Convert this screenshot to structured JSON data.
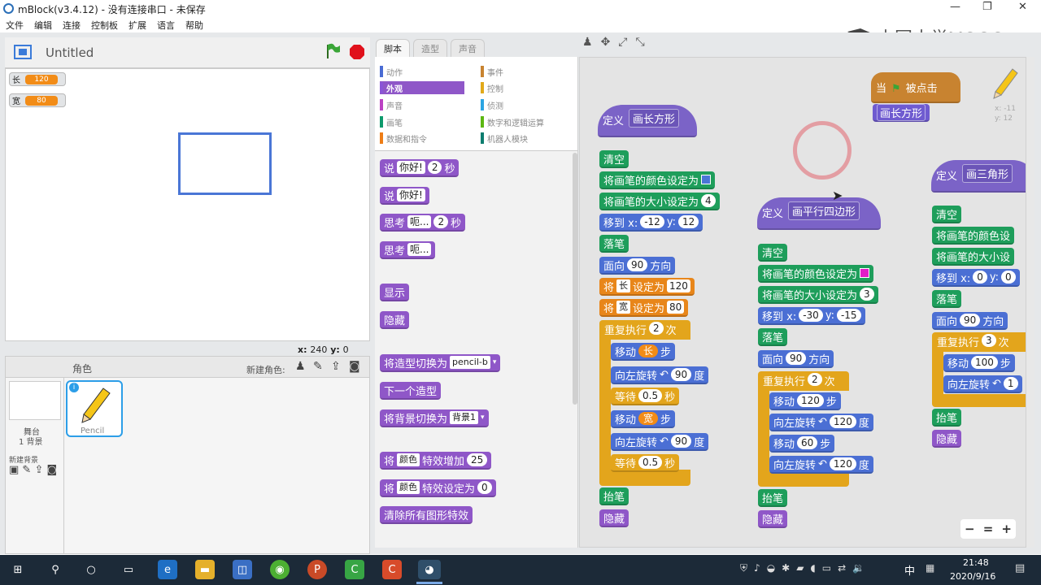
{
  "window": {
    "title": "mBlock(v3.4.12) - 没有连接串口 - 未保存",
    "minimize": "—",
    "maximize": "❐",
    "close": "✕"
  },
  "menu": [
    "文件",
    "编辑",
    "连接",
    "控制板",
    "扩展",
    "语言",
    "帮助"
  ],
  "watermark": "中国大学MOOC",
  "stage": {
    "title": "Untitled",
    "monitors": [
      {
        "label": "长",
        "value": "120"
      },
      {
        "label": "宽",
        "value": "80"
      }
    ],
    "coords": {
      "x_label": "x:",
      "x": "240",
      "y_label": "y:",
      "y": "0"
    }
  },
  "sprites": {
    "header": "角色",
    "new_sprite": "新建角色:",
    "stage_label": "舞台",
    "stage_bg": "1 背景",
    "new_bg": "新建背景",
    "sprite_name": "Pencil"
  },
  "tabs": [
    "脚本",
    "造型",
    "声音"
  ],
  "categories_left": [
    {
      "label": "动作",
      "color": "#4a6cd4"
    },
    {
      "label": "外观",
      "color": "#8a55d7"
    },
    {
      "label": "声音",
      "color": "#bb42c3"
    },
    {
      "label": "画笔",
      "color": "#0e9a6c"
    },
    {
      "label": "数据和指令",
      "color": "#ee7d16"
    }
  ],
  "categories_right": [
    {
      "label": "事件",
      "color": "#c88330"
    },
    {
      "label": "控制",
      "color": "#e1a91a"
    },
    {
      "label": "侦测",
      "color": "#2ca5e2"
    },
    {
      "label": "数字和逻辑运算",
      "color": "#5cb712"
    },
    {
      "label": "机器人模块",
      "color": "#0c7d6f"
    }
  ],
  "palette": {
    "say_secs": {
      "t1": "说",
      "in": "你好!",
      "n": "2",
      "t2": "秒"
    },
    "say": {
      "t1": "说",
      "in": "你好!"
    },
    "think_secs": {
      "t1": "思考",
      "in": "呃...",
      "n": "2",
      "t2": "秒"
    },
    "think": {
      "t1": "思考",
      "in": "呃..."
    },
    "show": "显示",
    "hide": "隐藏",
    "switch_costume": {
      "t": "将造型切换为",
      "v": "pencil-b"
    },
    "next_costume": "下一个造型",
    "switch_bg": {
      "t": "将背景切换为",
      "v": "背景1"
    },
    "change_effect": {
      "t1": "将",
      "v": "颜色",
      "t2": "特效增加",
      "n": "25"
    },
    "set_effect": {
      "t1": "将",
      "v": "颜色",
      "t2": "特效设定为",
      "n": "0"
    },
    "clear_effects": "清除所有图形特效"
  },
  "scripts": {
    "when_flag": {
      "t1": "当",
      "t2": "被点击",
      "call": "画长方形"
    },
    "rect": {
      "define": "定义",
      "name": "画长方形",
      "clear": "清空",
      "set_color": "将画笔的颜色设定为",
      "set_size": "将画笔的大小设定为",
      "size": "4",
      "goto": "移到 x:",
      "x": "-12",
      "y_lbl": "y:",
      "y": "12",
      "pen_down": "落笔",
      "point": "面向",
      "dir": "90",
      "dir_t": "方向",
      "set1": {
        "t1": "将",
        "var": "长",
        "t2": "设定为",
        "v": "120"
      },
      "set2": {
        "t1": "将",
        "var": "宽",
        "t2": "设定为",
        "v": "80"
      },
      "repeat": "重复执行",
      "times": "2",
      "times_t": "次",
      "move": "移动",
      "step": "步",
      "var_len": "长",
      "var_wid": "宽",
      "turn": "向左旋转",
      "deg": "90",
      "deg_t": "度",
      "wait": "等待",
      "secs": "0.5",
      "secs_t": "秒",
      "pen_up": "抬笔",
      "hide": "隐藏"
    },
    "para": {
      "define": "定义",
      "name": "画平行四边形",
      "clear": "清空",
      "set_color": "将画笔的颜色设定为",
      "set_size": "将画笔的大小设定为",
      "size": "3",
      "goto": "移到 x:",
      "x": "-30",
      "y_lbl": "y:",
      "y": "-15",
      "pen_down": "落笔",
      "point": "面向",
      "dir": "90",
      "dir_t": "方向",
      "repeat": "重复执行",
      "times": "2",
      "times_t": "次",
      "move": "移动",
      "m1": "120",
      "m2": "60",
      "step": "步",
      "turn": "向左旋转",
      "deg": "120",
      "deg_t": "度",
      "pen_up": "抬笔",
      "hide": "隐藏"
    },
    "tri": {
      "define": "定义",
      "name": "画三角形",
      "clear": "清空",
      "set_color": "将画笔的颜色设",
      "set_size": "将画笔的大小设",
      "goto": "移到 x:",
      "x": "0",
      "y_lbl": "y:",
      "y": "0",
      "pen_down": "落笔",
      "point": "面向",
      "dir": "90",
      "dir_t": "方向",
      "repeat": "重复执行",
      "times": "3",
      "times_t": "次",
      "move": "移动",
      "m": "100",
      "step": "步",
      "turn": "向左旋转",
      "deg": "1",
      "pen_up": "抬笔",
      "hide": "隐藏"
    }
  },
  "pencil_coords": {
    "x": "x: -11",
    "y": "y: 12"
  },
  "zoom": {
    "out": "−",
    "reset": "=",
    "in": "+"
  },
  "taskbar": {
    "time": "21:48",
    "date": "2020/9/16",
    "ime": "中"
  }
}
